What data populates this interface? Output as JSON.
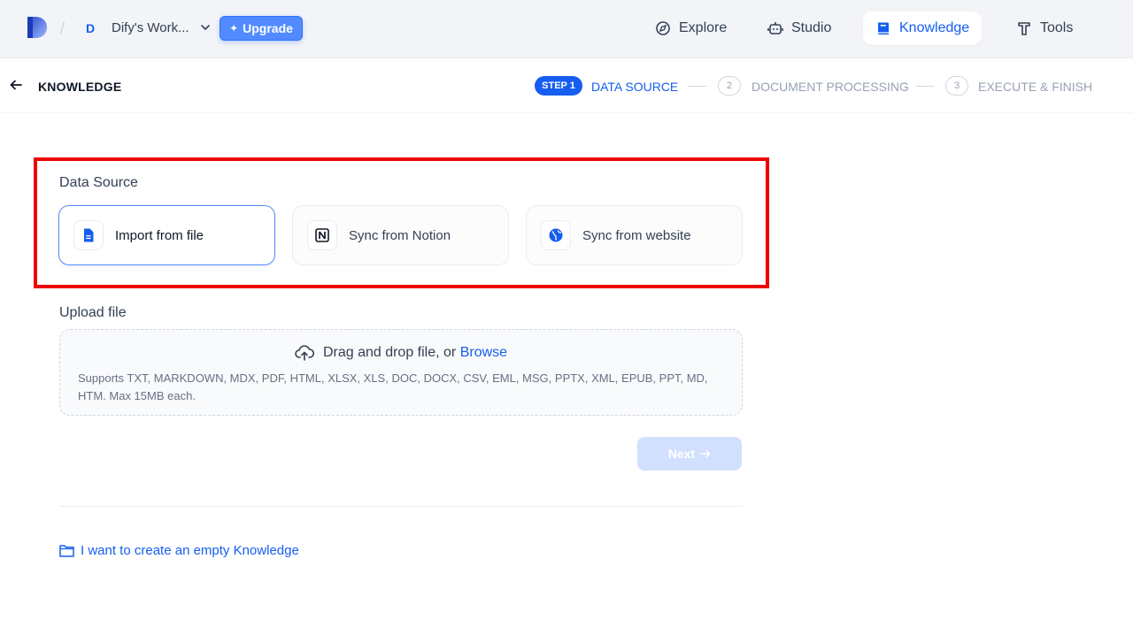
{
  "header": {
    "workspace_initial": "D",
    "workspace_name": "Dify's Work...",
    "upgrade_label": "Upgrade",
    "nav": {
      "explore": "Explore",
      "studio": "Studio",
      "knowledge": "Knowledge",
      "tools": "Tools"
    },
    "active_nav": "knowledge"
  },
  "steps": {
    "page_title": "KNOWLEDGE",
    "step1_badge": "STEP 1",
    "step1_label": "DATA SOURCE",
    "step2_number": "2",
    "step2_label": "DOCUMENT PROCESSING",
    "step3_number": "3",
    "step3_label": "EXECUTE & FINISH"
  },
  "data_source": {
    "title": "Data Source",
    "options": [
      {
        "label": "Import from file",
        "icon": "file-icon",
        "selected": true
      },
      {
        "label": "Sync from Notion",
        "icon": "notion-icon",
        "selected": false
      },
      {
        "label": "Sync from website",
        "icon": "globe-icon",
        "selected": false
      }
    ]
  },
  "upload": {
    "title": "Upload file",
    "drag_text": "Drag and drop file, or",
    "browse_label": "Browse",
    "hint": "Supports TXT, MARKDOWN, MDX, PDF, HTML, XLSX, XLS, DOC, DOCX, CSV, EML, MSG, PPTX, XML, EPUB, PPT, MD, HTM. Max 15MB each."
  },
  "next_label": "Next",
  "empty_knowledge_label": "I want to create an empty Knowledge",
  "colors": {
    "accent": "#155eef",
    "highlight_border": "#ee0000",
    "next_disabled": "#d1e0ff"
  }
}
